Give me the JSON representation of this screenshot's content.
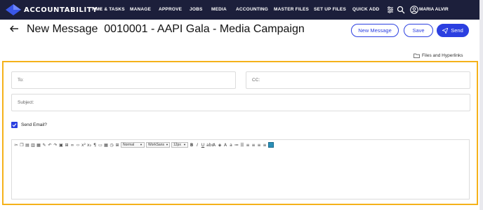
{
  "nav": {
    "logo_text": "ACCOUNTABILITY",
    "logo_tm": "™",
    "items": [
      "TIME & TASKS",
      "MANAGE",
      "APPROVE",
      "JOBS",
      "MEDIA",
      "ACCOUNTING",
      "MASTER FILES",
      "SET UP FILES",
      "QUICK ADD"
    ],
    "user_name": "MARIA ALVIR",
    "icons": [
      "filter-icon",
      "search-icon",
      "user-icon"
    ]
  },
  "header": {
    "title": "New Message  0010001 - AAPI Gala - Media Campaign",
    "buttons": {
      "new_message": "New Message",
      "save": "Save",
      "send": "Send"
    },
    "files_link": "Files and Hyperlinks"
  },
  "form": {
    "to_placeholder": "To:",
    "cc_placeholder": "CC:",
    "subject_placeholder": "Subject:",
    "send_email_label": "Send Email?",
    "send_email_checked": true
  },
  "toolbar": {
    "format_select": "Normal",
    "font_select": "WorkSans",
    "size_select": "12px",
    "bold": "B",
    "italic": "I",
    "underline": "U"
  },
  "colors": {
    "nav_bg": "#1c1f3b",
    "accent": "#2b3fe0",
    "highlight": "#f5b21a"
  }
}
